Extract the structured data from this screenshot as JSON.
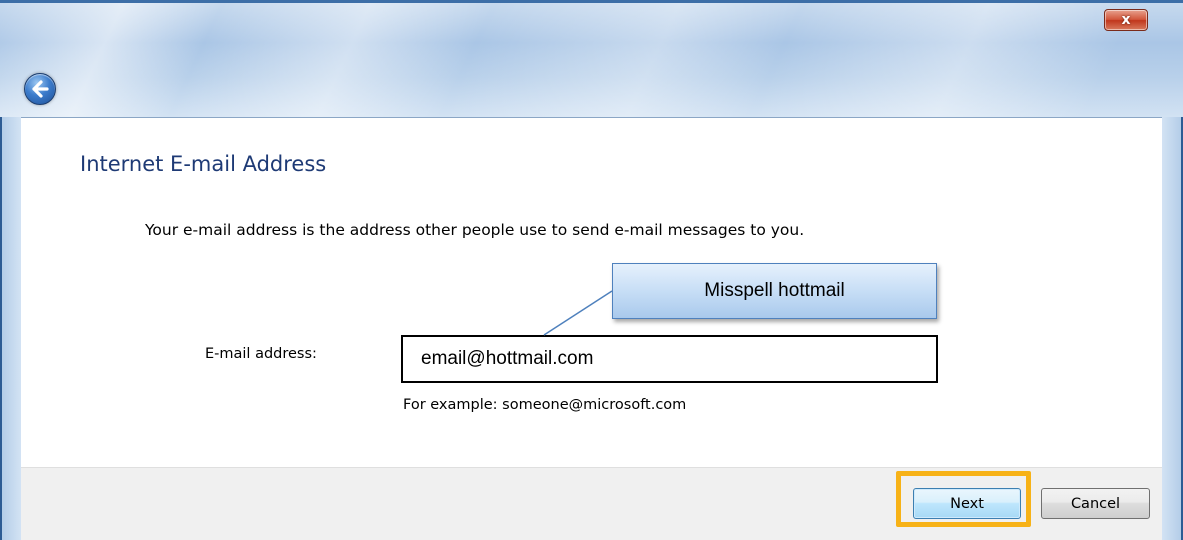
{
  "window": {
    "close_glyph": "x"
  },
  "wizard": {
    "heading": "Internet E-mail Address",
    "description": "Your e-mail address is the address other people use to send e-mail messages to you.",
    "email_label": "E-mail address:",
    "email_value": "email@hottmail.com",
    "example": "For example: someone@microsoft.com"
  },
  "annotation": {
    "callout_text": "Misspell hottmail",
    "highlight_color": "#f7b217"
  },
  "footer": {
    "next_label": "Next",
    "cancel_label": "Cancel"
  },
  "icons": {
    "back": "back-arrow-icon",
    "close": "close-icon"
  },
  "colors": {
    "heading": "#1e3a75",
    "callout_border": "#4f81bd",
    "next_border": "#3c7fb1"
  }
}
